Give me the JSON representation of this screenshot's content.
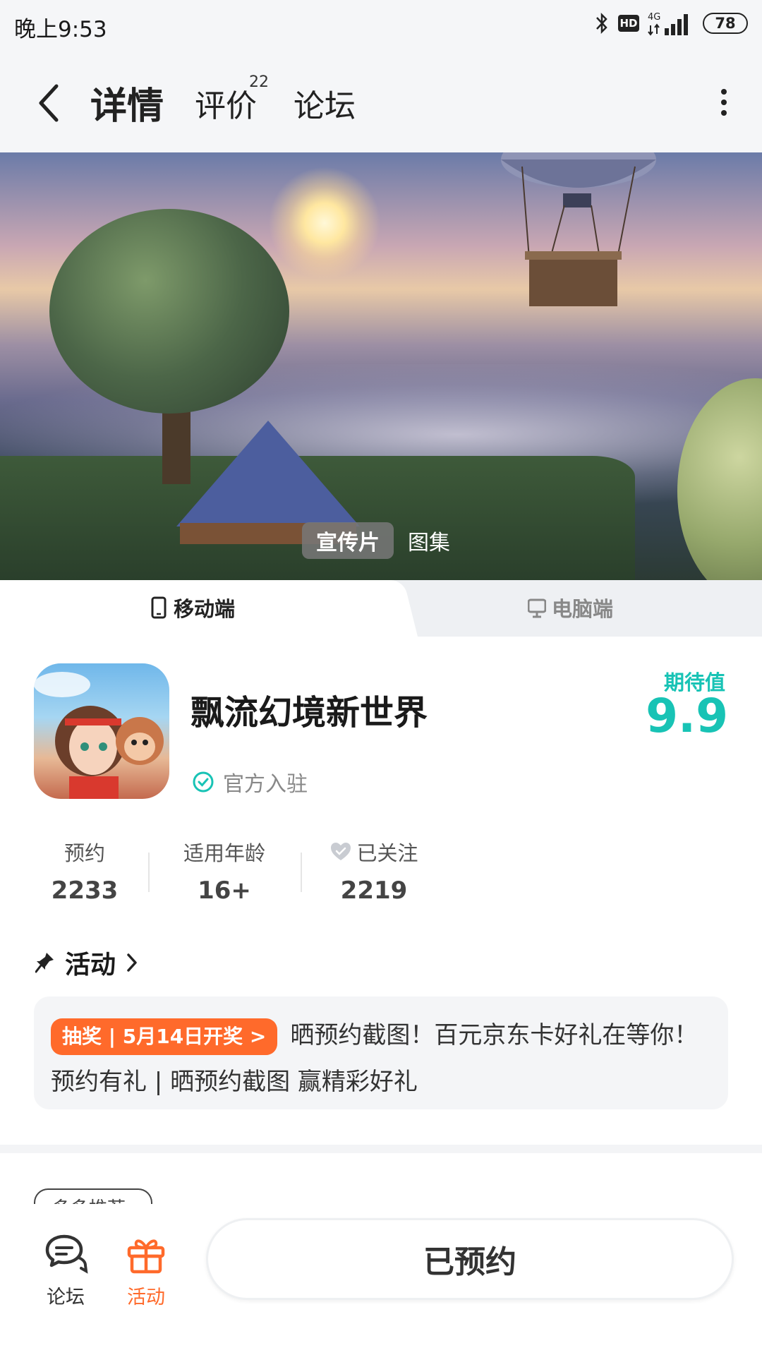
{
  "status_bar": {
    "time": "晚上9:53",
    "hd": "HD",
    "network": "4G",
    "battery": "78"
  },
  "nav": {
    "tabs": [
      {
        "label": "详情",
        "active": true
      },
      {
        "label": "评价",
        "badge": "22"
      },
      {
        "label": "论坛"
      }
    ],
    "accent_color": "#18c3b5"
  },
  "banner": {
    "media_tabs": [
      {
        "label": "宣传片",
        "active": true
      },
      {
        "label": "图集"
      }
    ]
  },
  "platform_tabs": [
    {
      "label": "移动端",
      "icon": "phone-icon",
      "active": true
    },
    {
      "label": "电脑端",
      "icon": "monitor-icon"
    }
  ],
  "app": {
    "title": "飘流幻境新世界",
    "official_label": "官方入驻",
    "expect_label": "期待值",
    "expect_score": "9.9"
  },
  "stats": [
    {
      "label": "预约",
      "value": "2233"
    },
    {
      "label": "适用年龄",
      "value": "16+"
    },
    {
      "label": "已关注",
      "value": "2219",
      "icon": "heart-icon"
    }
  ],
  "activity": {
    "title": "活动",
    "badge": "抽奖 | 5月14日开奖 >",
    "text": "晒预约截图！百元京东卡好礼在等你！ 预约有礼 | 晒预约截图 赢精彩好礼",
    "badge_color": "#ff6a2b"
  },
  "next_section": {
    "chip": "多多推荐"
  },
  "bottom_bar": {
    "items": [
      {
        "label": "论坛",
        "icon": "chat-icon"
      },
      {
        "label": "活动",
        "icon": "gift-icon",
        "color": "#ff6a2b"
      }
    ],
    "primary_button": "已预约"
  }
}
